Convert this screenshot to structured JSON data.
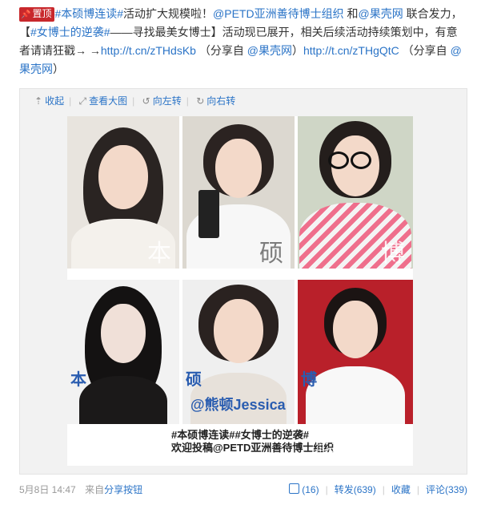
{
  "post": {
    "pin_label": "置顶",
    "tag1": "#本硕博连读#",
    "t1": "活动扩大规模啦！",
    "mention1": "@PETD亚洲善待博士组织",
    "t2": " 和",
    "mention2": "@果壳网",
    "t3": " 联合发力，【",
    "tag2": "#女博士的逆袭#",
    "t4": "——寻找最美女博士】活动现已展开，相关后续活动持续策划中，有意者请请狂戳→ →",
    "link1": "http://t.cn/zTHdsKb",
    "t5": " （分享自 ",
    "mention3": "@果壳网",
    "t6": "）",
    "link2": "http://t.cn/zTHgQtC",
    "t7": " （分享自 ",
    "mention4": "@果壳网",
    "t8": "）"
  },
  "toolbar": {
    "collapse": "收起",
    "view_large": "查看大图",
    "rotate_left": "向左转",
    "rotate_right": "向右转"
  },
  "collage": {
    "row1_chars": [
      "本",
      "硕",
      "博"
    ],
    "row2_chars": [
      "本",
      "硕",
      "博"
    ],
    "name_label": "@熊顿Jessica",
    "banner_line1": "#本硕博连读##女博士的逆袭#",
    "banner_line2": "欢迎投稿@PETD亚洲善待博士组织",
    "watermark": "@PETD亚洲善待博士组织"
  },
  "footer": {
    "date": "5月8日 14:47",
    "via_prefix": "来自",
    "via_source": "分享按钮",
    "likes": "(16)",
    "repost": "转发(639)",
    "favorite": "收藏",
    "comment": "评论(339)"
  },
  "colors": {
    "link": "#2b74c7",
    "pin": "#c8282c"
  }
}
